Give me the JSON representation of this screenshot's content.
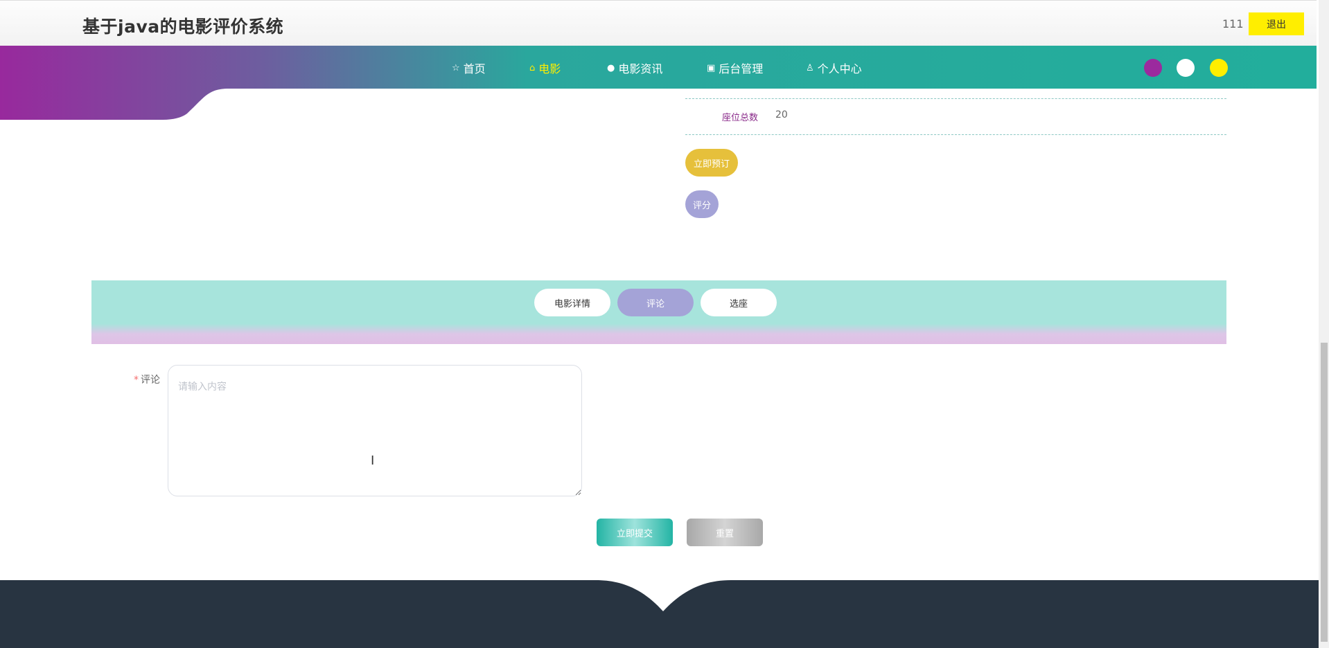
{
  "header": {
    "title": "基于java的电影评价系统",
    "username": "111",
    "logout_label": "退出"
  },
  "nav": {
    "items": [
      {
        "label": "首页",
        "icon": "star-icon"
      },
      {
        "label": "电影",
        "icon": "bag-icon",
        "active": true
      },
      {
        "label": "电影资讯",
        "icon": "info-icon"
      },
      {
        "label": "后台管理",
        "icon": "building-icon"
      },
      {
        "label": "个人中心",
        "icon": "user-icon"
      }
    ],
    "theme_colors": [
      "#9b2a9e",
      "#ffffff",
      "#ffee00"
    ]
  },
  "movie_info": {
    "seat_label": "座位总数",
    "seat_value": "20",
    "book_button": "立即预订",
    "rate_button": "评分"
  },
  "tabs": [
    {
      "label": "电影详情"
    },
    {
      "label": "评论",
      "active": true
    },
    {
      "label": "选座"
    }
  ],
  "comment_form": {
    "label": "评论",
    "required_mark": "*",
    "placeholder": "请输入内容",
    "value": "",
    "submit_label": "立即提交",
    "reset_label": "重置"
  },
  "colors": {
    "teal": "#23b4a4",
    "purple": "#9b2a9e",
    "yellow": "#ffee00",
    "lavender": "#a4a3d7",
    "gold": "#e6c03b",
    "footer": "#283441"
  }
}
